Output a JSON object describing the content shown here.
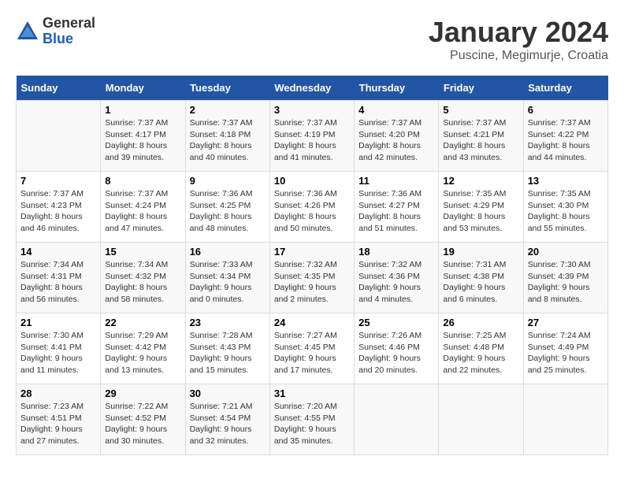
{
  "header": {
    "logo_general": "General",
    "logo_blue": "Blue",
    "month_title": "January 2024",
    "location": "Puscine, Megimurje, Croatia"
  },
  "days_of_week": [
    "Sunday",
    "Monday",
    "Tuesday",
    "Wednesday",
    "Thursday",
    "Friday",
    "Saturday"
  ],
  "weeks": [
    [
      {
        "day": "",
        "content": ""
      },
      {
        "day": "1",
        "content": "Sunrise: 7:37 AM\nSunset: 4:17 PM\nDaylight: 8 hours\nand 39 minutes."
      },
      {
        "day": "2",
        "content": "Sunrise: 7:37 AM\nSunset: 4:18 PM\nDaylight: 8 hours\nand 40 minutes."
      },
      {
        "day": "3",
        "content": "Sunrise: 7:37 AM\nSunset: 4:19 PM\nDaylight: 8 hours\nand 41 minutes."
      },
      {
        "day": "4",
        "content": "Sunrise: 7:37 AM\nSunset: 4:20 PM\nDaylight: 8 hours\nand 42 minutes."
      },
      {
        "day": "5",
        "content": "Sunrise: 7:37 AM\nSunset: 4:21 PM\nDaylight: 8 hours\nand 43 minutes."
      },
      {
        "day": "6",
        "content": "Sunrise: 7:37 AM\nSunset: 4:22 PM\nDaylight: 8 hours\nand 44 minutes."
      }
    ],
    [
      {
        "day": "7",
        "content": "Sunrise: 7:37 AM\nSunset: 4:23 PM\nDaylight: 8 hours\nand 46 minutes."
      },
      {
        "day": "8",
        "content": "Sunrise: 7:37 AM\nSunset: 4:24 PM\nDaylight: 8 hours\nand 47 minutes."
      },
      {
        "day": "9",
        "content": "Sunrise: 7:36 AM\nSunset: 4:25 PM\nDaylight: 8 hours\nand 48 minutes."
      },
      {
        "day": "10",
        "content": "Sunrise: 7:36 AM\nSunset: 4:26 PM\nDaylight: 8 hours\nand 50 minutes."
      },
      {
        "day": "11",
        "content": "Sunrise: 7:36 AM\nSunset: 4:27 PM\nDaylight: 8 hours\nand 51 minutes."
      },
      {
        "day": "12",
        "content": "Sunrise: 7:35 AM\nSunset: 4:29 PM\nDaylight: 8 hours\nand 53 minutes."
      },
      {
        "day": "13",
        "content": "Sunrise: 7:35 AM\nSunset: 4:30 PM\nDaylight: 8 hours\nand 55 minutes."
      }
    ],
    [
      {
        "day": "14",
        "content": "Sunrise: 7:34 AM\nSunset: 4:31 PM\nDaylight: 8 hours\nand 56 minutes."
      },
      {
        "day": "15",
        "content": "Sunrise: 7:34 AM\nSunset: 4:32 PM\nDaylight: 8 hours\nand 58 minutes."
      },
      {
        "day": "16",
        "content": "Sunrise: 7:33 AM\nSunset: 4:34 PM\nDaylight: 9 hours\nand 0 minutes."
      },
      {
        "day": "17",
        "content": "Sunrise: 7:32 AM\nSunset: 4:35 PM\nDaylight: 9 hours\nand 2 minutes."
      },
      {
        "day": "18",
        "content": "Sunrise: 7:32 AM\nSunset: 4:36 PM\nDaylight: 9 hours\nand 4 minutes."
      },
      {
        "day": "19",
        "content": "Sunrise: 7:31 AM\nSunset: 4:38 PM\nDaylight: 9 hours\nand 6 minutes."
      },
      {
        "day": "20",
        "content": "Sunrise: 7:30 AM\nSunset: 4:39 PM\nDaylight: 9 hours\nand 8 minutes."
      }
    ],
    [
      {
        "day": "21",
        "content": "Sunrise: 7:30 AM\nSunset: 4:41 PM\nDaylight: 9 hours\nand 11 minutes."
      },
      {
        "day": "22",
        "content": "Sunrise: 7:29 AM\nSunset: 4:42 PM\nDaylight: 9 hours\nand 13 minutes."
      },
      {
        "day": "23",
        "content": "Sunrise: 7:28 AM\nSunset: 4:43 PM\nDaylight: 9 hours\nand 15 minutes."
      },
      {
        "day": "24",
        "content": "Sunrise: 7:27 AM\nSunset: 4:45 PM\nDaylight: 9 hours\nand 17 minutes."
      },
      {
        "day": "25",
        "content": "Sunrise: 7:26 AM\nSunset: 4:46 PM\nDaylight: 9 hours\nand 20 minutes."
      },
      {
        "day": "26",
        "content": "Sunrise: 7:25 AM\nSunset: 4:48 PM\nDaylight: 9 hours\nand 22 minutes."
      },
      {
        "day": "27",
        "content": "Sunrise: 7:24 AM\nSunset: 4:49 PM\nDaylight: 9 hours\nand 25 minutes."
      }
    ],
    [
      {
        "day": "28",
        "content": "Sunrise: 7:23 AM\nSunset: 4:51 PM\nDaylight: 9 hours\nand 27 minutes."
      },
      {
        "day": "29",
        "content": "Sunrise: 7:22 AM\nSunset: 4:52 PM\nDaylight: 9 hours\nand 30 minutes."
      },
      {
        "day": "30",
        "content": "Sunrise: 7:21 AM\nSunset: 4:54 PM\nDaylight: 9 hours\nand 32 minutes."
      },
      {
        "day": "31",
        "content": "Sunrise: 7:20 AM\nSunset: 4:55 PM\nDaylight: 9 hours\nand 35 minutes."
      },
      {
        "day": "",
        "content": ""
      },
      {
        "day": "",
        "content": ""
      },
      {
        "day": "",
        "content": ""
      }
    ]
  ]
}
